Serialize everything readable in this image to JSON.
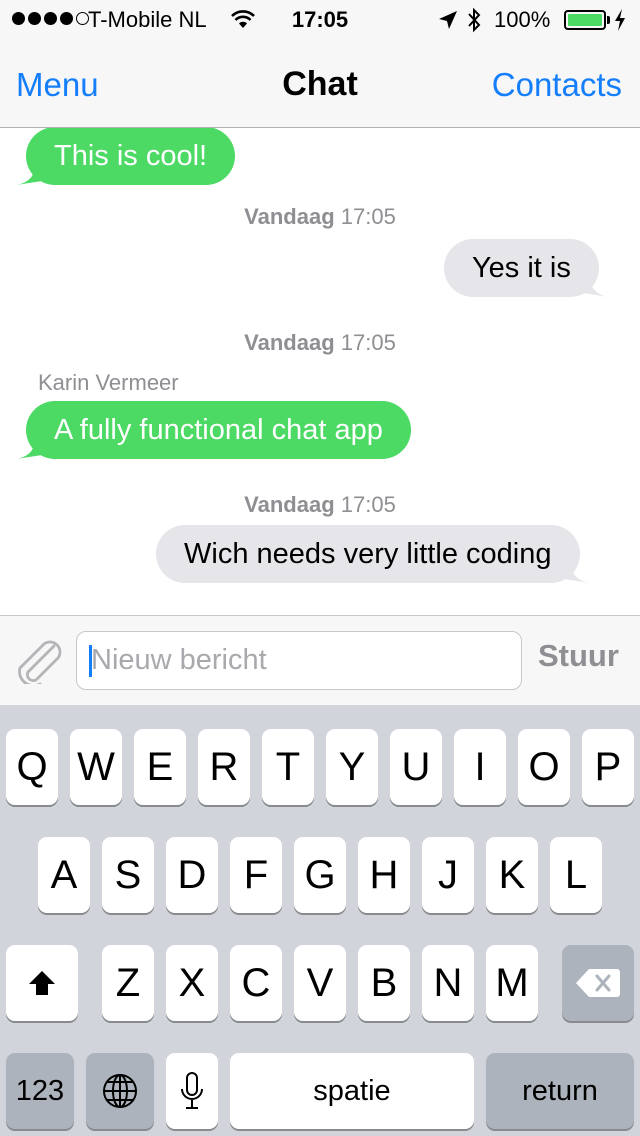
{
  "status_bar": {
    "carrier": "T-Mobile NL",
    "time": "17:05",
    "battery": "100%",
    "battery_level": 1.0,
    "signal_bars": 4,
    "signal_max": 5
  },
  "nav": {
    "left": "Menu",
    "title": "Chat",
    "right": "Contacts"
  },
  "messages": [
    {
      "direction": "in",
      "text": "This is cool!"
    },
    {
      "stamp_day": "Vandaag",
      "stamp_time": "17:05"
    },
    {
      "direction": "out",
      "text": "Yes it is"
    },
    {
      "stamp_day": "Vandaag",
      "stamp_time": "17:05"
    },
    {
      "sender": "Karin Vermeer",
      "direction": "in",
      "text": "A fully functional chat app"
    },
    {
      "stamp_day": "Vandaag",
      "stamp_time": "17:05"
    },
    {
      "direction": "out",
      "text": "Wich needs very little coding"
    }
  ],
  "composer": {
    "placeholder": "Nieuw bericht",
    "send_label": "Stuur"
  },
  "keyboard": {
    "row1": [
      "Q",
      "W",
      "E",
      "R",
      "T",
      "Y",
      "U",
      "I",
      "O",
      "P"
    ],
    "row2": [
      "A",
      "S",
      "D",
      "F",
      "G",
      "H",
      "J",
      "K",
      "L"
    ],
    "row3": [
      "Z",
      "X",
      "C",
      "V",
      "B",
      "N",
      "M"
    ],
    "numbers_label": "123",
    "space_label": "spatie",
    "return_label": "return"
  },
  "icons": {
    "attach": "paperclip-icon",
    "shift": "shift-arrow-icon",
    "delete": "backspace-icon",
    "globe": "globe-icon",
    "mic": "microphone-icon"
  },
  "colors": {
    "accent": "#157efb",
    "incoming_bubble": "#4cd964",
    "outgoing_bubble": "#e5e5ea",
    "keyboard_bg": "#d1d5db"
  }
}
